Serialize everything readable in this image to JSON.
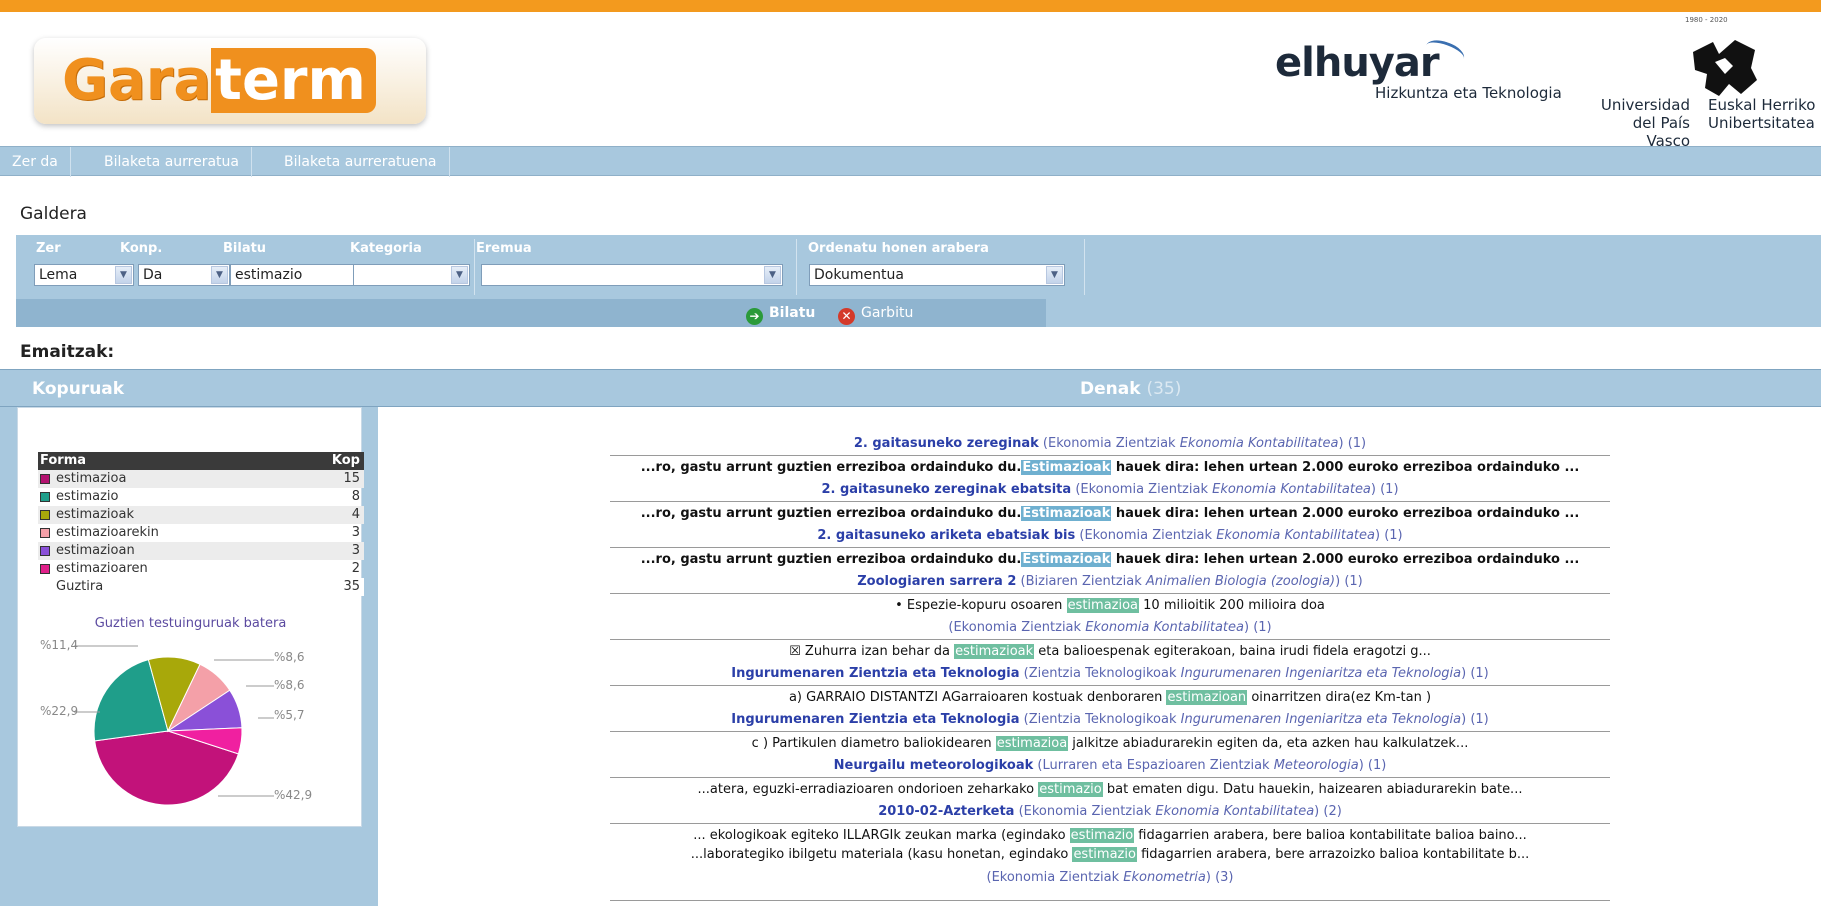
{
  "header": {
    "logo_part1": "Gara",
    "logo_part2": "term",
    "elhuyar_name": "elhuyar",
    "elhuyar_sub": "Hizkuntza eta Teknologia",
    "upv_tiny": "1980 - 2020",
    "upv_es_line1": "Universidad",
    "upv_es_line2": "del País Vasco",
    "upv_eu_line1": "Euskal Herriko",
    "upv_eu_line2": "Unibertsitatea"
  },
  "nav": [
    "Zer da",
    "Bilaketa aurreratua",
    "Bilaketa aurreratuena"
  ],
  "query": {
    "section_title": "Galdera",
    "labels": {
      "zer": "Zer",
      "konp": "Konp.",
      "bilatu": "Bilatu",
      "kategoria": "Kategoria",
      "eremua": "Eremua",
      "ordenatu": "Ordenatu honen arabera"
    },
    "values": {
      "zer": "Lema",
      "konp": "Da",
      "bilatu": "estimazio",
      "kategoria": "",
      "eremua": "",
      "ordenatu": "Dokumentua"
    },
    "search_button": "Bilatu",
    "clear_button": "Garbitu"
  },
  "results": {
    "section_title": "Emaitzak:",
    "left_header": "Kopuruak",
    "center_header": "Denak",
    "center_count": "(35)",
    "table_header": {
      "forma": "Forma",
      "kop": "Kop"
    },
    "forms": [
      {
        "name": "estimazioa",
        "count": "15",
        "color": "#b3126f"
      },
      {
        "name": "estimazio",
        "count": "8",
        "color": "#1f9e8a"
      },
      {
        "name": "estimazioak",
        "count": "4",
        "color": "#a8a80a"
      },
      {
        "name": "estimazioarekin",
        "count": "3",
        "color": "#f4a0a8"
      },
      {
        "name": "estimazioan",
        "count": "3",
        "color": "#8a50d8"
      },
      {
        "name": "estimazioaren",
        "count": "2",
        "color": "#e0208a"
      }
    ],
    "total_label": "Guztira",
    "total_count": "35",
    "pie_title": "Guztien testuinguruak batera",
    "pie_labels": [
      "%11,4",
      "%8,6",
      "%8,6",
      "%22,9",
      "%5,7",
      "%42,9"
    ]
  },
  "chart_data": {
    "type": "pie",
    "title": "Guztien testuinguruak batera",
    "labels": [
      "estimazioa",
      "estimazio",
      "estimazioak",
      "estimazioarekin",
      "estimazioan",
      "estimazioaren"
    ],
    "values": [
      42.9,
      22.9,
      11.4,
      8.6,
      8.6,
      5.7
    ],
    "colors": [
      "#c2127a",
      "#1f9e8a",
      "#a8a80a",
      "#f4a0a8",
      "#8a50d8",
      "#f020a0"
    ]
  },
  "list": {
    "entries": [
      {
        "kind": "title",
        "link": "2. gaitasuneko zereginak",
        "cat": "(Ekonomia Zientziak",
        "sub": "Ekonomia Kontabilitatea",
        "tail": ") (1)"
      },
      {
        "kind": "snip",
        "bold": true,
        "pre": "...ro, gastu arrunt guztien erreziboa ordainduko du.",
        "hl": "Estimazioak",
        "post": " hauek dira: lehen urtean 2.000 euroko erreziboa ordainduko ...",
        "hlc": "hlb"
      },
      {
        "kind": "title",
        "link": "2. gaitasuneko zereginak ebatsita",
        "cat": "(Ekonomia Zientziak",
        "sub": "Ekonomia Kontabilitatea",
        "tail": ") (1)"
      },
      {
        "kind": "snip",
        "bold": true,
        "pre": "...ro, gastu arrunt guztien erreziboa ordainduko du.",
        "hl": "Estimazioak",
        "post": " hauek dira: lehen urtean 2.000 euroko erreziboa ordainduko ...",
        "hlc": "hlb"
      },
      {
        "kind": "title",
        "link": "2. gaitasuneko ariketa ebatsiak bis",
        "cat": "(Ekonomia Zientziak",
        "sub": "Ekonomia Kontabilitatea",
        "tail": ") (1)"
      },
      {
        "kind": "snip",
        "bold": true,
        "pre": "...ro, gastu arrunt guztien erreziboa ordainduko du.",
        "hl": "Estimazioak",
        "post": " hauek dira: lehen urtean 2.000 euroko erreziboa ordainduko ...",
        "hlc": "hlb"
      },
      {
        "kind": "title",
        "link": "Zoologiaren sarrera 2",
        "cat": "(Biziaren Zientziak",
        "sub": "Animalien Biologia (zoologia)",
        "tail": ") (1)"
      },
      {
        "kind": "snip",
        "bold": false,
        "pre": "• Espezie-kopuru osoaren ",
        "hl": "estimazioa",
        "post": " 10 milioitik 200 milioira doa",
        "hlc": "hl"
      },
      {
        "kind": "title",
        "link": "",
        "cat": "(Ekonomia Zientziak",
        "sub": "Ekonomia Kontabilitatea",
        "tail": ") (1)"
      },
      {
        "kind": "snip",
        "bold": false,
        "pre": "☒ Zuhurra izan behar da ",
        "hl": "estimazioak",
        "post": " eta balioespenak egiterakoan, baina irudi fidela eragotzi g...",
        "hlc": "hl"
      },
      {
        "kind": "title",
        "link": "Ingurumenaren Zientzia eta Teknologia",
        "cat": "(Zientzia Teknologikoak",
        "sub": "Ingurumenaren Ingeniaritza eta Teknologia",
        "tail": ") (1)"
      },
      {
        "kind": "snip",
        "bold": false,
        "pre": "a) GARRAIO DISTANTZI AGarraioaren kostuak denboraren ",
        "hl": "estimazioan",
        "post": " oinarritzen dira(ez Km-tan )",
        "hlc": "hl"
      },
      {
        "kind": "title",
        "link": "Ingurumenaren Zientzia eta Teknologia",
        "cat": "(Zientzia Teknologikoak",
        "sub": "Ingurumenaren Ingeniaritza eta Teknologia",
        "tail": ") (1)"
      },
      {
        "kind": "snip",
        "bold": false,
        "pre": "c ) Partikulen diametro baliokidearen ",
        "hl": "estimazioa",
        "post": " jalkitze abiadurarekin egiten da, eta azken hau kalkulatzek...",
        "hlc": "hl"
      },
      {
        "kind": "title",
        "link": "Neurgailu meteorologikoak",
        "cat": "(Lurraren eta Espazioaren Zientziak",
        "sub": "Meteorologia",
        "tail": ") (1)"
      },
      {
        "kind": "snip",
        "bold": false,
        "pre": "...atera, eguzki-erradiazioaren ondorioen zeharkako ",
        "hl": "estimazio",
        "post": " bat ematen digu. Datu hauekin, haizearen abiadurarekin bate...",
        "hlc": "hl"
      },
      {
        "kind": "title",
        "link": "2010-02-Azterketa",
        "cat": "(Ekonomia Zientziak",
        "sub": "Ekonomia Kontabilitatea",
        "tail": ") (2)"
      },
      {
        "kind": "snip",
        "bold": false,
        "pre": "... ekologikoak egiteko ILLARGIk zeukan marka (egindako ",
        "hl": "estimazio",
        "post": " fidagarrien arabera, bere balioa kontabilitate balioa baino...",
        "hlc": "hl"
      },
      {
        "kind": "snip2",
        "bold": false,
        "pre": "...laborategiko ibilgetu materiala (kasu honetan, egindako ",
        "hl": "estimazio",
        "post": " fidagarrien arabera, bere arrazoizko balioa kontabilitate b...",
        "hlc": "hl"
      },
      {
        "kind": "title",
        "link": "",
        "cat": "(Ekonomia Zientziak",
        "sub": "Ekonometria",
        "tail": ") (3)"
      }
    ]
  }
}
